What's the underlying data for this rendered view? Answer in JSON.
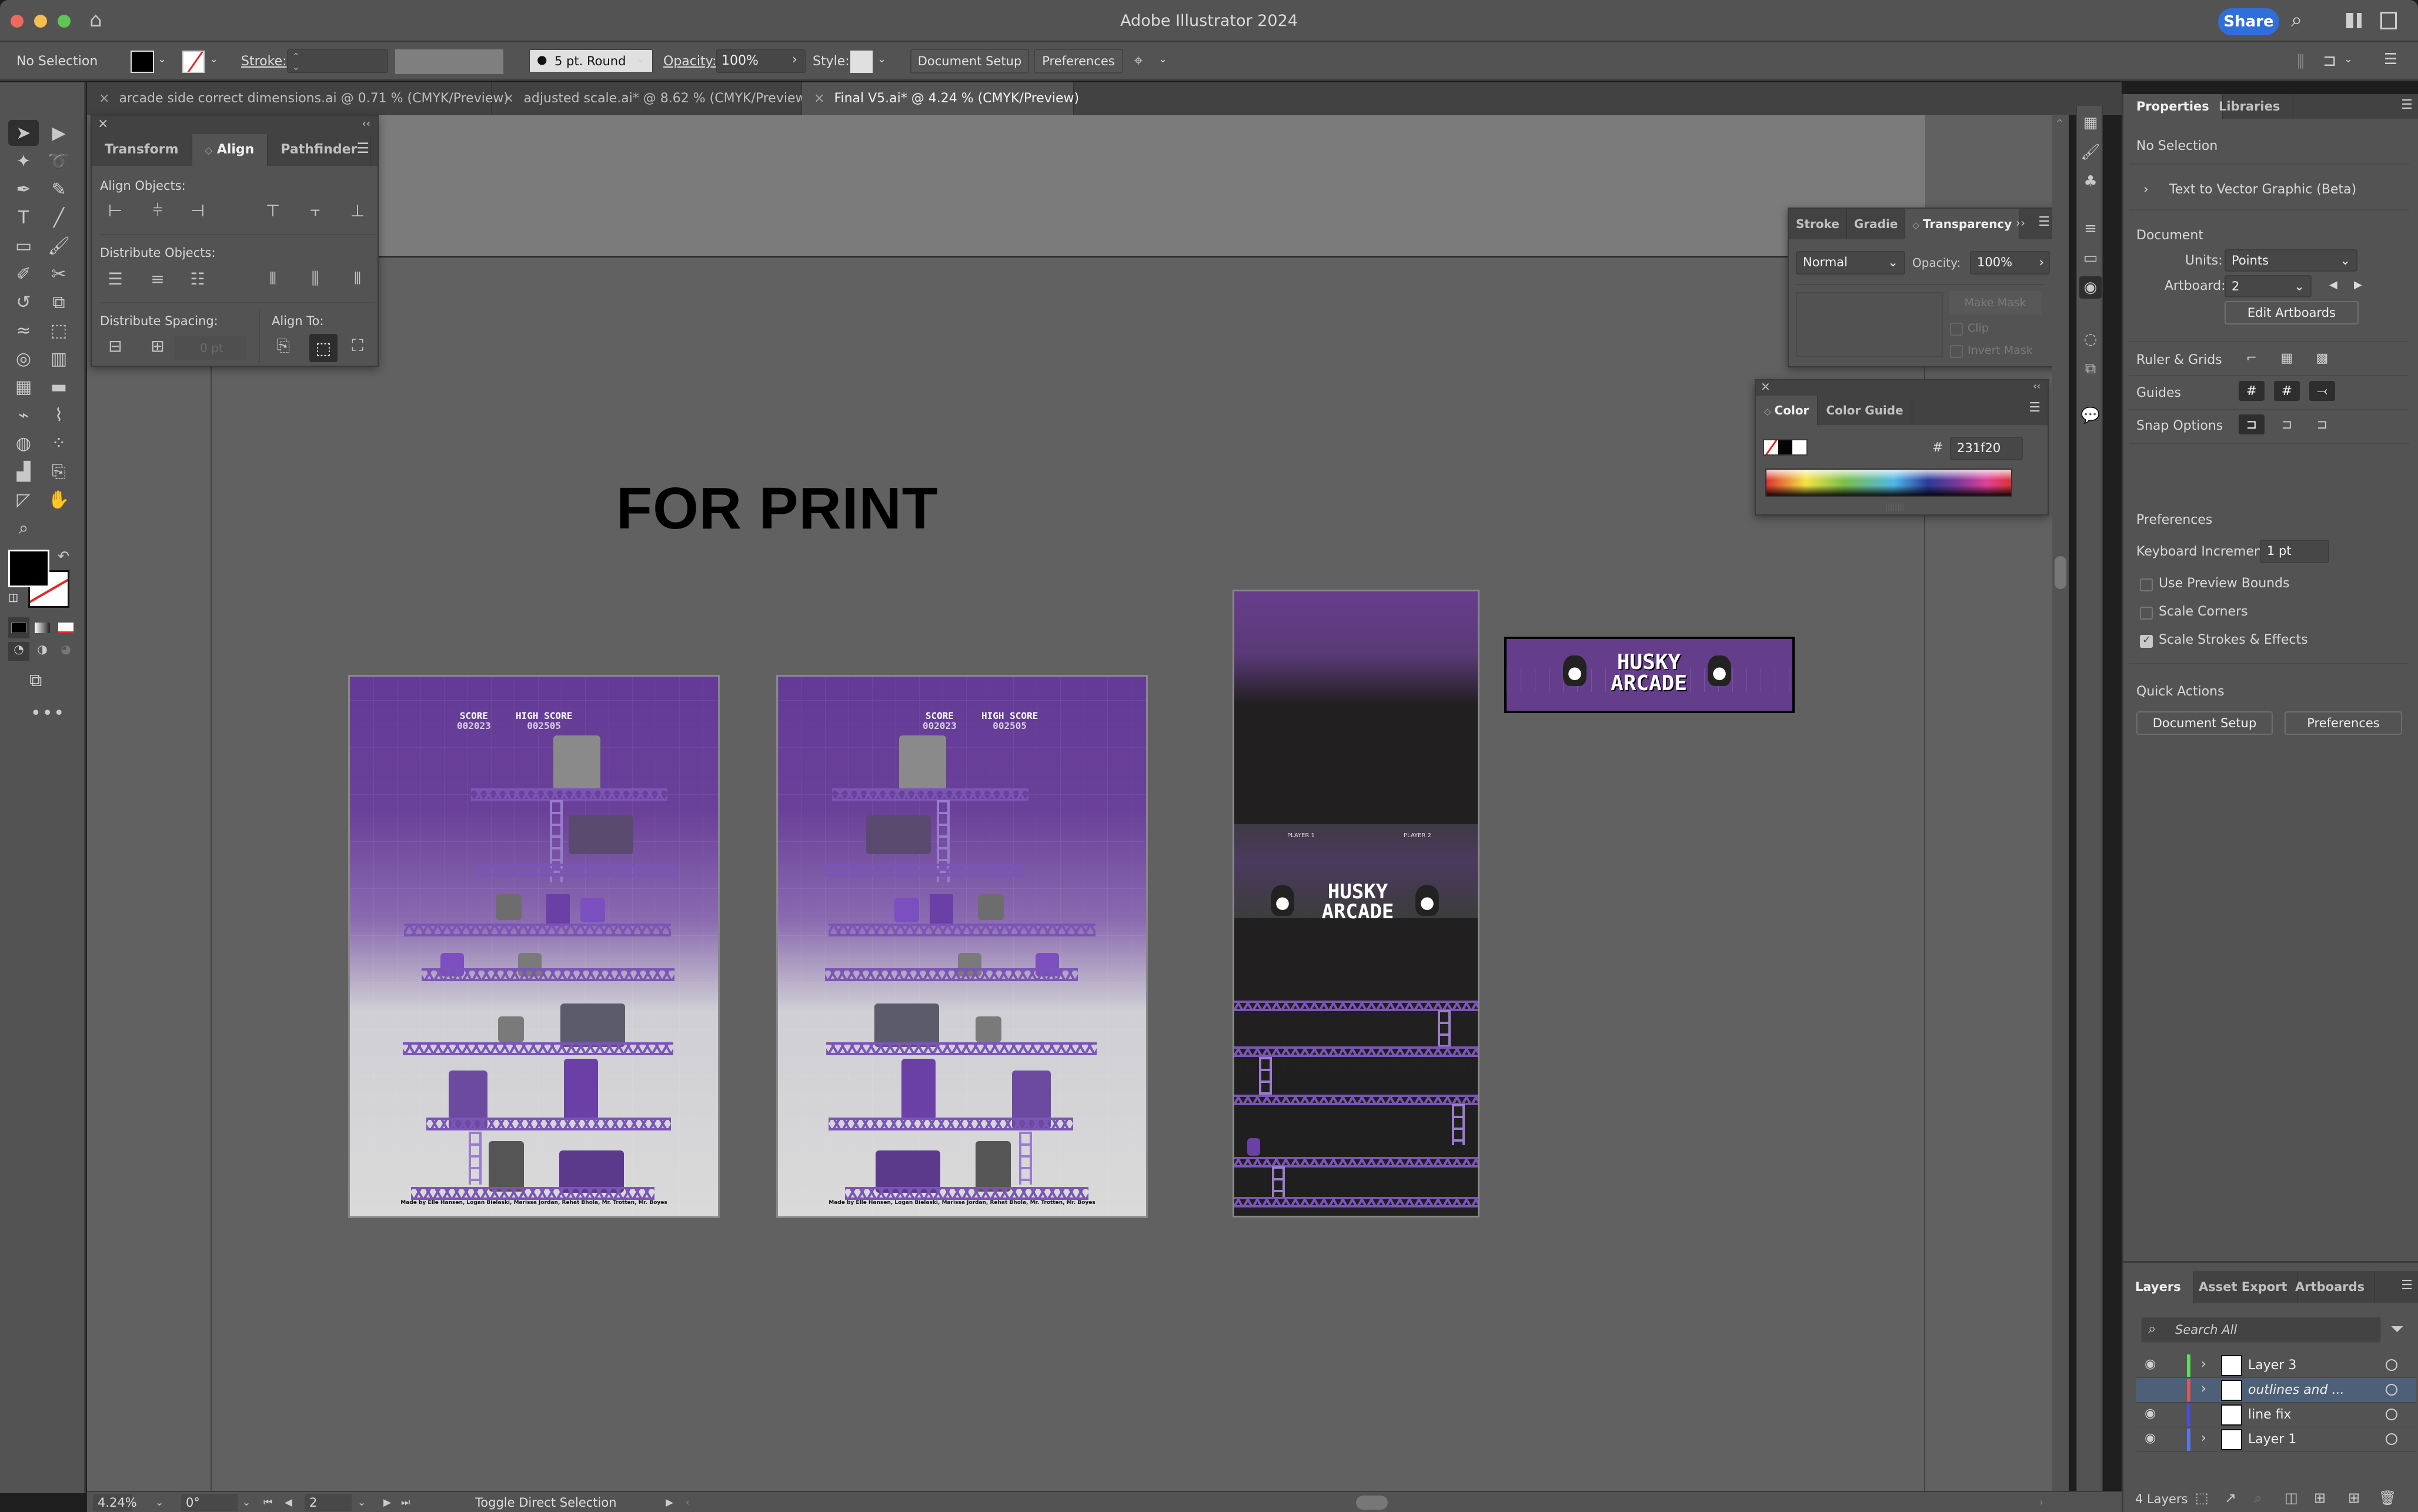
{
  "window": {
    "title": "Adobe Illustrator 2024",
    "share_label": "Share"
  },
  "control_bar": {
    "selection_status": "No Selection",
    "stroke_label": "Stroke:",
    "stroke_value": "",
    "brush_value": "5 pt. Round",
    "opacity_label": "Opacity:",
    "opacity_value": "100%",
    "style_label": "Style:",
    "document_setup_label": "Document Setup",
    "preferences_label": "Preferences"
  },
  "document_tabs": [
    {
      "label": "arcade side correct dimensions.ai @ 0.71 % (CMYK/Preview)",
      "active": false
    },
    {
      "label": "adjusted scale.ai* @ 8.62 % (CMYK/Preview)",
      "active": false
    },
    {
      "label": "Final V5.ai* @ 4.24 % (CMYK/Preview)",
      "active": true
    }
  ],
  "tools": [
    "selection-tool",
    "direct-selection-tool",
    "magic-wand-tool",
    "lasso-tool",
    "pen-tool",
    "curvature-tool",
    "type-tool",
    "line-segment-tool",
    "rectangle-tool",
    "paintbrush-tool",
    "shaper-tool",
    "scissors-tool",
    "rotate-tool",
    "scale-tool",
    "warp-tool",
    "free-transform-tool",
    "shape-builder-tool",
    "perspective-grid-tool",
    "mesh-tool",
    "gradient-tool",
    "eyedropper-blend-tool",
    "eyedropper-tool",
    "blend-tool",
    "symbol-sprayer-tool",
    "column-graph-tool",
    "artboard-tool",
    "slice-tool",
    "hand-tool",
    "zoom-tool"
  ],
  "fill_stroke": {
    "fill_color": "#000000",
    "stroke": "none"
  },
  "canvas": {
    "headline": "FOR PRINT",
    "poster_left": {
      "score_label": "SCORE",
      "score_value": "002023",
      "high_score_label": "HIGH SCORE",
      "high_score_value": "002505",
      "credits": "Made by Elle Hansen, Logan Bielaski, Marissa Jordan, Rehat Bhola, Mr. Trotten, Mr. Boyes"
    },
    "poster_right": {
      "score_label": "SCORE",
      "score_value": "002023",
      "high_score_label": "HIGH SCORE",
      "high_score_value": "002505",
      "credits": "Made by Elle Hansen, Logan Bielaski, Marissa Jordan, Rehat Bhola, Mr. Trotten, Mr. Boyes"
    },
    "arcade_side": {
      "player1_label": "PLAYER 1",
      "player2_label": "PLAYER 2",
      "title_line1": "HUSKY",
      "title_line2": "ARCADE"
    },
    "marquee": {
      "title_line1": "HUSKY",
      "title_line2": "ARCADE"
    },
    "brand_purple": "#653e8b"
  },
  "align_panel": {
    "tabs": [
      "Transform",
      "Align",
      "Pathfinder"
    ],
    "active_tab": "Align",
    "align_objects_label": "Align Objects:",
    "distribute_objects_label": "Distribute Objects:",
    "distribute_spacing_label": "Distribute Spacing:",
    "spacing_value": "0 pt",
    "align_to_label": "Align To:"
  },
  "transparency_panel": {
    "tabs": [
      "Stroke",
      "Gradie",
      "Transparency"
    ],
    "active_tab": "Transparency",
    "blend_mode": "Normal",
    "opacity_label": "Opacity:",
    "opacity_value": "100%",
    "make_mask_label": "Make Mask",
    "clip_label": "Clip",
    "invert_mask_label": "Invert Mask"
  },
  "color_panel": {
    "tabs": [
      "Color",
      "Color Guide"
    ],
    "active_tab": "Color",
    "hash_label": "#",
    "hex_value": "231f20"
  },
  "properties_panel": {
    "tabs": [
      "Properties",
      "Libraries"
    ],
    "active_tab": "Properties",
    "selection_status": "No Selection",
    "text_to_vector_label": "Text to Vector Graphic (Beta)",
    "document_heading": "Document",
    "units_label": "Units:",
    "units_value": "Points",
    "artboard_label": "Artboard:",
    "artboard_value": "2",
    "edit_artboards_label": "Edit Artboards",
    "ruler_grids_label": "Ruler & Grids",
    "guides_label": "Guides",
    "snap_options_label": "Snap Options",
    "preferences_heading": "Preferences",
    "keyboard_increment_label": "Keyboard Increment:",
    "keyboard_increment_value": "1 pt",
    "checkboxes": [
      {
        "label": "Use Preview Bounds",
        "checked": false
      },
      {
        "label": "Scale Corners",
        "checked": false
      },
      {
        "label": "Scale Strokes & Effects",
        "checked": true
      }
    ],
    "quick_actions_heading": "Quick Actions",
    "document_setup_label": "Document Setup",
    "preferences_label": "Preferences"
  },
  "layers_panel": {
    "tabs": [
      "Layers",
      "Asset Export",
      "Artboards"
    ],
    "active_tab": "Layers",
    "search_placeholder": "Search All",
    "layers": [
      {
        "name": "Layer 3",
        "visible": true,
        "color": "#5be05b",
        "expandable": true,
        "selected": false
      },
      {
        "name": "outlines and ...",
        "visible": false,
        "color": "#e05555",
        "expandable": true,
        "selected": true
      },
      {
        "name": "line fix",
        "visible": true,
        "color": "#4b4bea",
        "expandable": false,
        "selected": false
      },
      {
        "name": "Layer 1",
        "visible": true,
        "color": "#5577ee",
        "expandable": true,
        "selected": false
      }
    ],
    "count_label": "4 Layers"
  },
  "status_bar": {
    "zoom": "4.24%",
    "rotation": "0°",
    "artboard": "2",
    "tool_hint": "Toggle Direct Selection"
  }
}
